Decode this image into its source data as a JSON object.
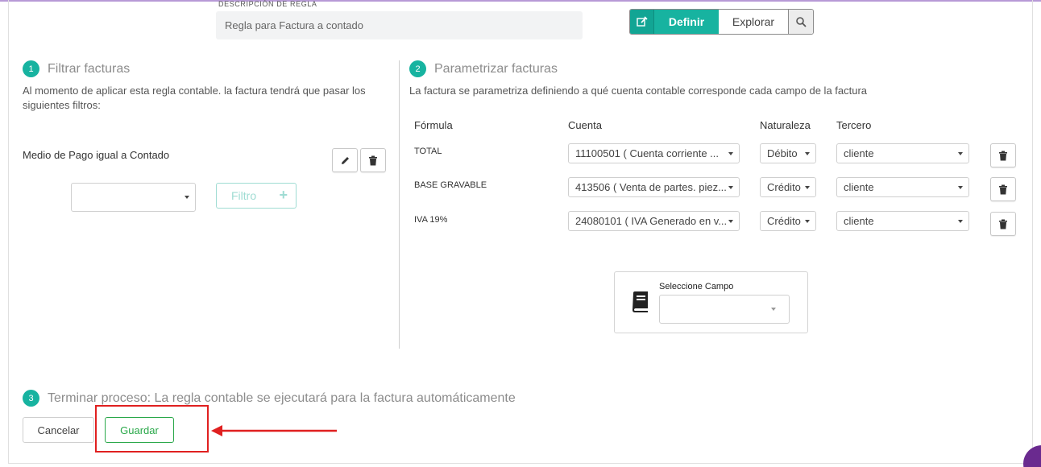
{
  "header": {
    "description_label": "DESCRIPCIÓN DE REGLA",
    "description_value": "Regla para Factura a contado",
    "modes": {
      "define_label": "Definir",
      "explore_label": "Explorar"
    }
  },
  "step1": {
    "number": "1",
    "title": "Filtrar facturas",
    "help": "Al momento de aplicar esta regla contable. la factura tendrá que pasar los siguientes filtros:",
    "filter_condition": "Medio de Pago igual a Contado",
    "field_select_value": "",
    "filter_button_label": "Filtro"
  },
  "step2": {
    "number": "2",
    "title": "Parametrizar facturas",
    "help": "La factura se parametriza definiendo a qué cuenta contable corresponde cada campo de la factura",
    "columns": {
      "formula": "Fórmula",
      "cuenta": "Cuenta",
      "naturaleza": "Naturaleza",
      "tercero": "Tercero"
    },
    "rows": [
      {
        "formula": "TOTAL",
        "cuenta": "11100501 ( Cuenta corriente ...",
        "naturaleza": "Débito",
        "tercero": "cliente"
      },
      {
        "formula": "BASE GRAVABLE",
        "cuenta": "413506 ( Venta de partes. piez...",
        "naturaleza": "Crédito",
        "tercero": "cliente"
      },
      {
        "formula": "IVA 19%",
        "cuenta": "24080101 ( IVA Generado en v...",
        "naturaleza": "Crédito",
        "tercero": "cliente"
      }
    ],
    "select_field_label": "Seleccione Campo",
    "select_field_value": ""
  },
  "step3": {
    "number": "3",
    "title": "Terminar proceso: La regla contable se ejecutará para la factura automáticamente",
    "cancel_label": "Cancelar",
    "save_label": "Guardar"
  },
  "colors": {
    "accent": "#17b3a0",
    "save": "#2aa84a",
    "highlight": "#e02020"
  },
  "icons": [
    "edit-square-icon",
    "search-icon",
    "pencil-icon",
    "trash-icon",
    "book-icon",
    "plus-icon",
    "arrow-left-icon"
  ]
}
